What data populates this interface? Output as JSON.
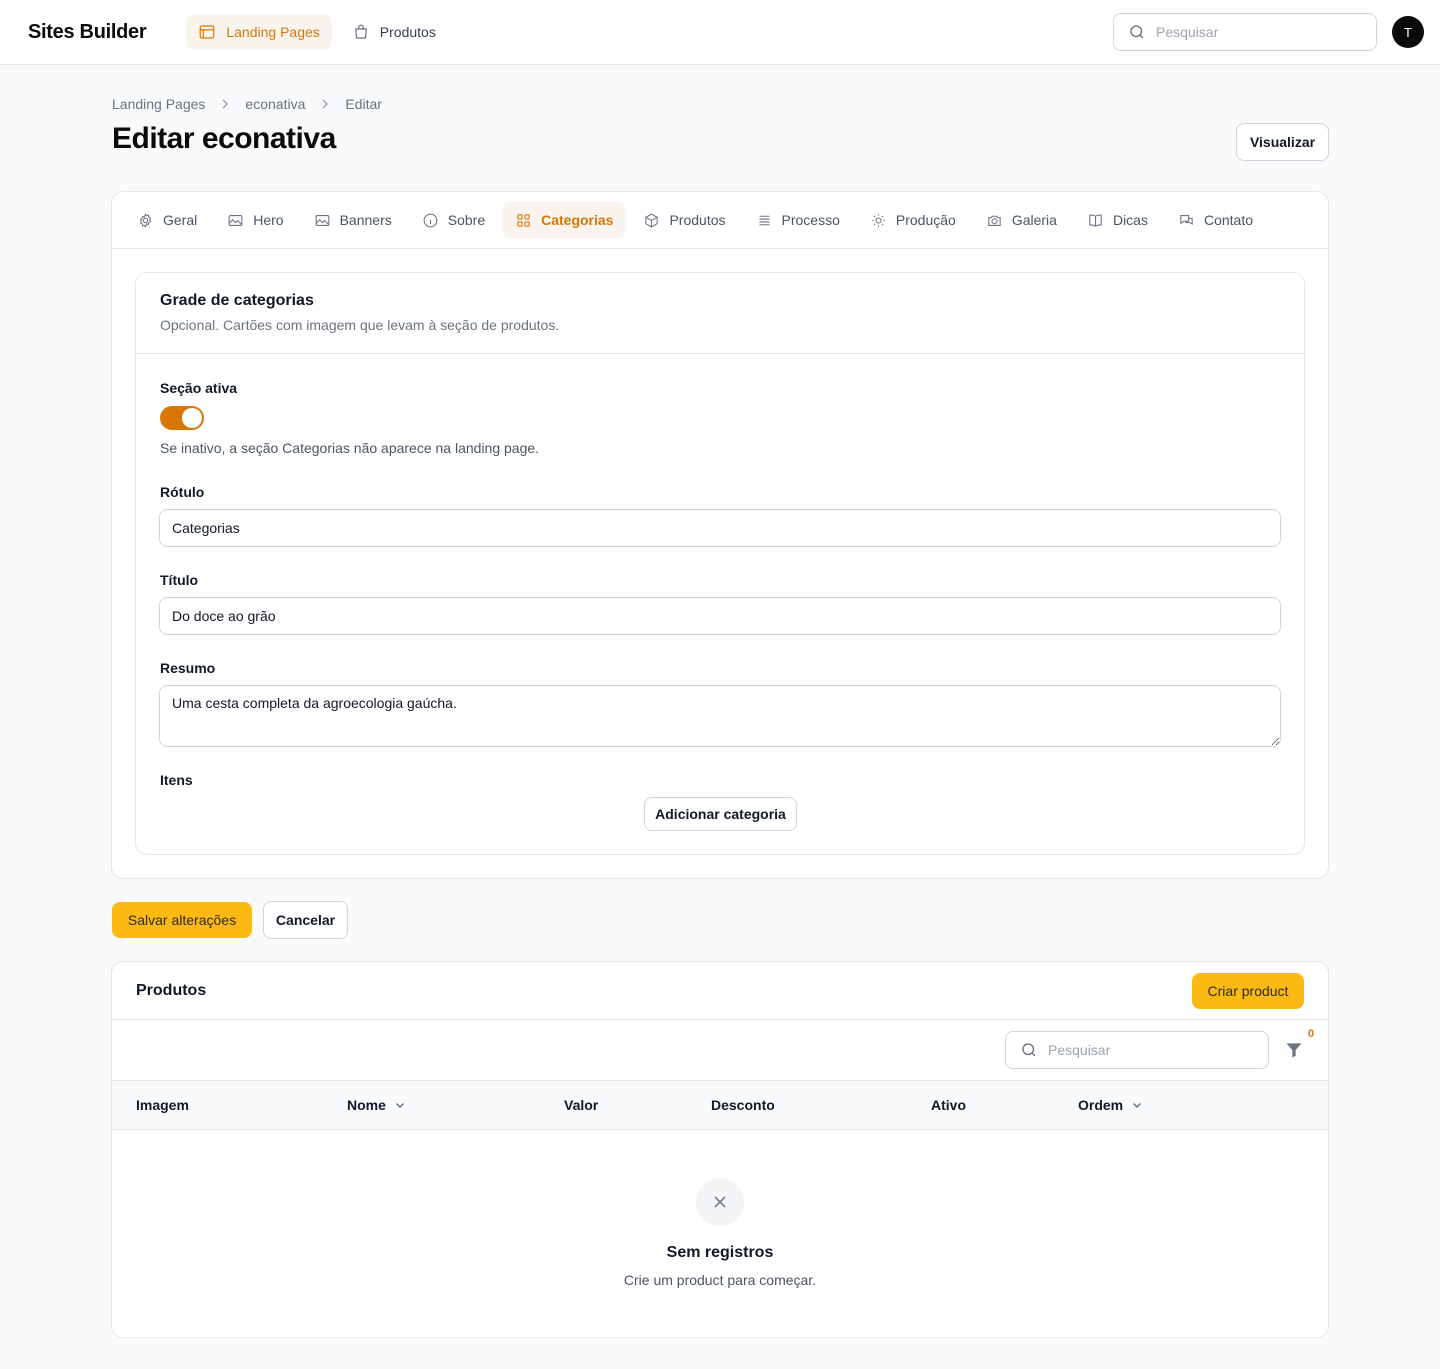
{
  "app": {
    "brand": "Sites Builder",
    "avatar_initial": "T",
    "accent_color": "#d97706",
    "primary_button_color": "#fcb913"
  },
  "topnav": [
    {
      "label": "Landing Pages",
      "icon": "window-icon",
      "active": true
    },
    {
      "label": "Produtos",
      "icon": "shopping-bag-icon",
      "active": false
    }
  ],
  "search": {
    "placeholder": "Pesquisar"
  },
  "breadcrumb": [
    "Landing Pages",
    "econativa",
    "Editar"
  ],
  "page": {
    "title": "Editar econativa",
    "view_label": "Visualizar"
  },
  "tabs": [
    {
      "label": "Geral",
      "icon": "gear-icon"
    },
    {
      "label": "Hero",
      "icon": "image-icon"
    },
    {
      "label": "Banners",
      "icon": "image-icon"
    },
    {
      "label": "Sobre",
      "icon": "info-icon"
    },
    {
      "label": "Categorias",
      "icon": "grid-icon",
      "active": true
    },
    {
      "label": "Produtos",
      "icon": "cube-icon"
    },
    {
      "label": "Processo",
      "icon": "list-icon"
    },
    {
      "label": "Produção",
      "icon": "sun-icon"
    },
    {
      "label": "Galeria",
      "icon": "camera-icon"
    },
    {
      "label": "Dicas",
      "icon": "book-icon"
    },
    {
      "label": "Contato",
      "icon": "chat-icon"
    }
  ],
  "section": {
    "title": "Grade de categorias",
    "description": "Opcional. Cartões com imagem que levam à seção de produtos.",
    "active_label": "Seção ativa",
    "active": true,
    "active_hint": "Se inativo, a seção Categorias não aparece na landing page.",
    "label_label": "Rótulo",
    "label_value": "Categorias",
    "title_label": "Título",
    "title_value": "Do doce ao grão",
    "summary_label": "Resumo",
    "summary_value": "Uma cesta completa da agroecologia gaúcha.",
    "items_label": "Itens",
    "add_label": "Adicionar categoria"
  },
  "form_actions": {
    "save": "Salvar alterações",
    "cancel": "Cancelar"
  },
  "products": {
    "title": "Produtos",
    "create_label": "Criar product",
    "search_placeholder": "Pesquisar",
    "filter_count": "0",
    "columns": [
      {
        "label": "Imagem",
        "sortable": false
      },
      {
        "label": "Nome",
        "sortable": true
      },
      {
        "label": "Valor",
        "sortable": false
      },
      {
        "label": "Desconto",
        "sortable": false
      },
      {
        "label": "Ativo",
        "sortable": false
      },
      {
        "label": "Ordem",
        "sortable": true
      }
    ],
    "empty_title": "Sem registros",
    "empty_desc": "Crie um product para começar."
  }
}
